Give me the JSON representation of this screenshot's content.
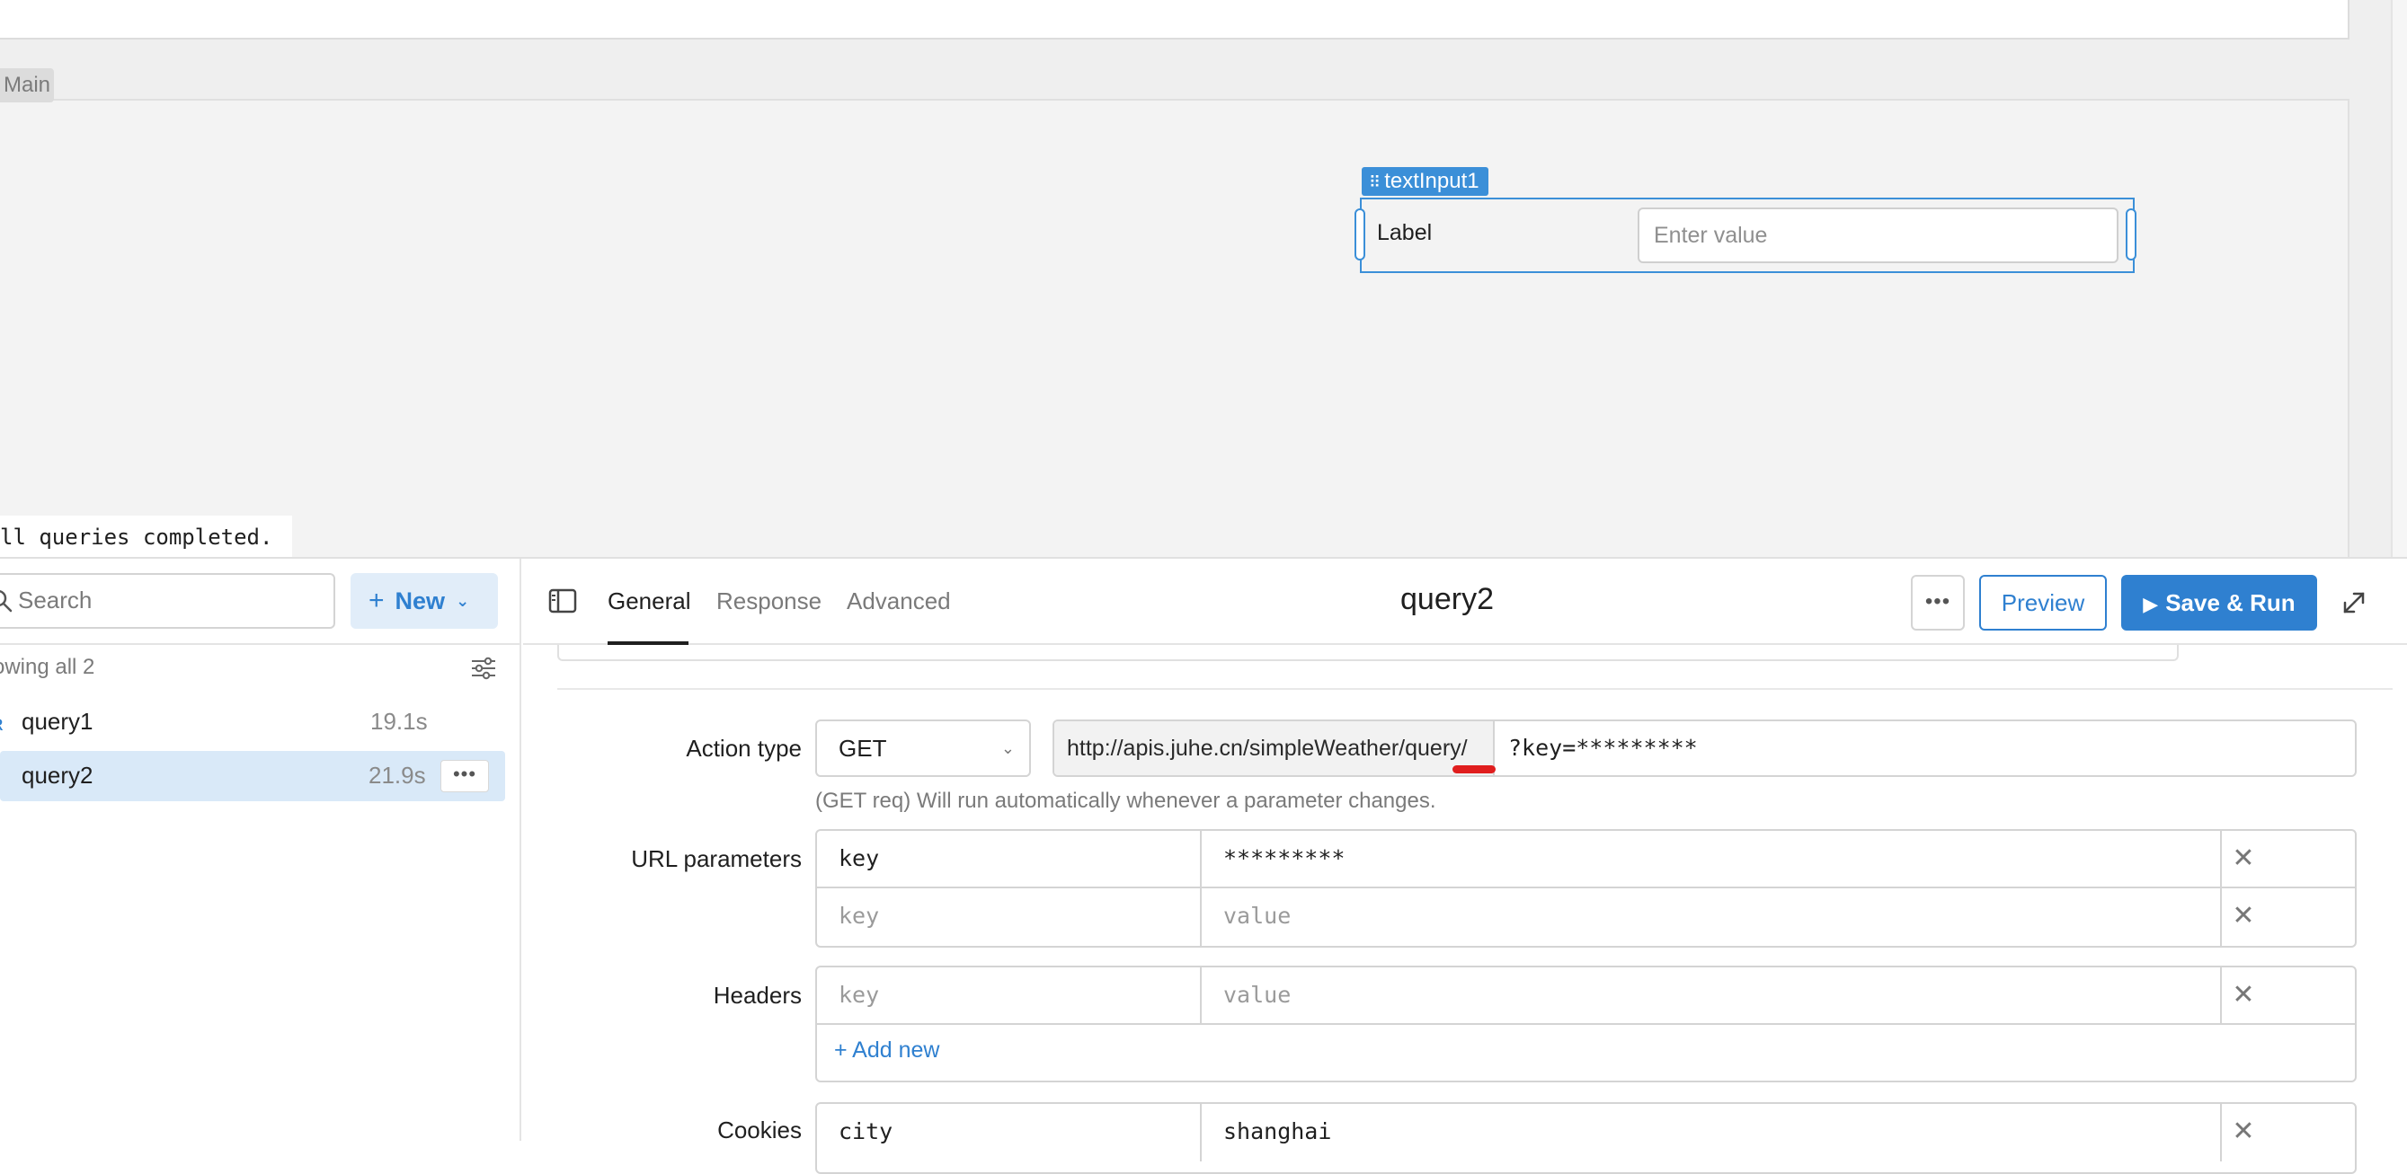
{
  "canvas": {
    "main_label": "Main",
    "text_input": {
      "component_name": "textInput1",
      "label": "Label",
      "placeholder": "Enter value"
    },
    "status_toast": "ll queries completed."
  },
  "sidebar": {
    "search_placeholder": "Search",
    "new_button": "New",
    "showing_text": "owing all 2",
    "queries": [
      {
        "name": "query1",
        "time": "19.1s",
        "selected": false
      },
      {
        "name": "query2",
        "time": "21.9s",
        "selected": true
      }
    ],
    "more_glyph": "•••"
  },
  "editor": {
    "tabs": {
      "general": "General",
      "response": "Response",
      "advanced": "Advanced"
    },
    "active_tab": "General",
    "title": "query2",
    "more_glyph": "•••",
    "preview_button": "Preview",
    "save_run_button": "Save & Run",
    "action_type": {
      "label": "Action type",
      "method": "GET",
      "url_base": "http://apis.juhe.cn/simpleWeather/query/",
      "url_query": "?key=*********",
      "helper": "(GET req) Will run automatically whenever a parameter changes."
    },
    "url_parameters": {
      "label": "URL parameters",
      "rows": [
        {
          "key": "key",
          "value": "*********",
          "is_placeholder": false
        },
        {
          "key": "key",
          "value": "value",
          "is_placeholder": true
        }
      ]
    },
    "headers": {
      "label": "Headers",
      "rows": [
        {
          "key": "key",
          "value": "value",
          "is_placeholder": true
        }
      ],
      "add_new": "+ Add new"
    },
    "cookies": {
      "label": "Cookies",
      "rows": [
        {
          "key": "city",
          "value": "shanghai",
          "is_placeholder": false
        }
      ]
    },
    "close_glyph": "✕"
  },
  "colors": {
    "accent": "#2f80d0",
    "selection": "#3b8fd8",
    "selected_row_bg": "#d9e9f8",
    "annotation_red": "#e01e1e"
  }
}
